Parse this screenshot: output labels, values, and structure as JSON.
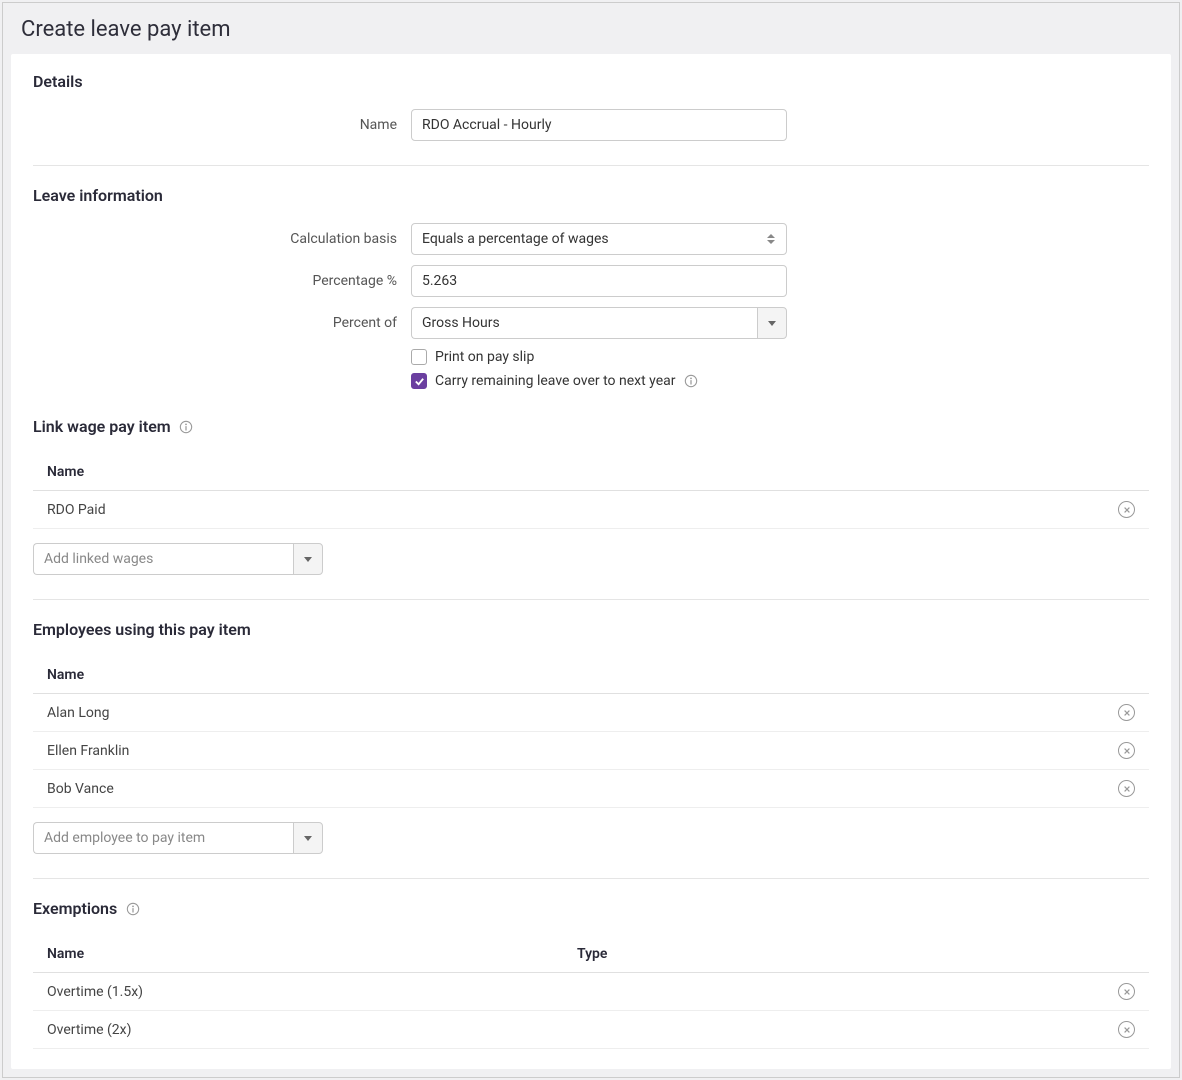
{
  "window": {
    "title": "Create leave pay item"
  },
  "details": {
    "heading": "Details",
    "name_label": "Name",
    "name_value": "RDO Accrual - Hourly"
  },
  "leave_info": {
    "heading": "Leave information",
    "calc_basis_label": "Calculation basis",
    "calc_basis_value": "Equals a percentage of wages",
    "percentage_label": "Percentage %",
    "percentage_value": "5.263",
    "percent_of_label": "Percent of",
    "percent_of_value": "Gross Hours",
    "print_label": "Print on pay slip",
    "print_checked": false,
    "carry_label": "Carry remaining leave over to next year",
    "carry_checked": true
  },
  "link_wage": {
    "heading": "Link wage pay item",
    "col_name": "Name",
    "rows": [
      {
        "name": "RDO Paid"
      }
    ],
    "add_placeholder": "Add linked wages"
  },
  "employees": {
    "heading": "Employees using this pay item",
    "col_name": "Name",
    "rows": [
      {
        "name": "Alan Long"
      },
      {
        "name": "Ellen Franklin"
      },
      {
        "name": "Bob Vance"
      }
    ],
    "add_placeholder": "Add employee to pay item"
  },
  "exemptions": {
    "heading": "Exemptions",
    "col_name": "Name",
    "col_type": "Type",
    "rows": [
      {
        "name": "Overtime (1.5x)",
        "type": ""
      },
      {
        "name": "Overtime (2x)",
        "type": ""
      }
    ]
  }
}
